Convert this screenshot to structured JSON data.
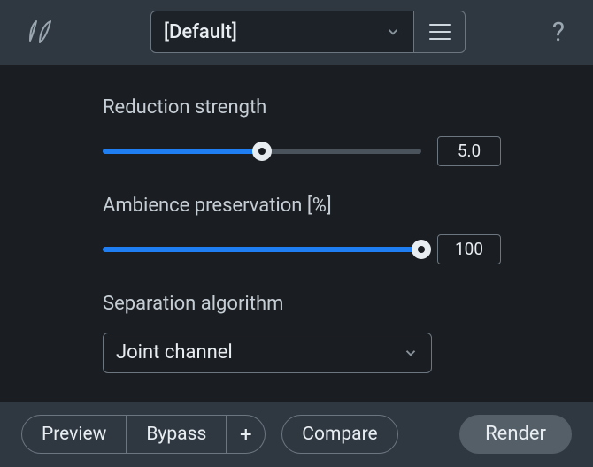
{
  "topbar": {
    "preset_value": "[Default]"
  },
  "controls": {
    "reduction": {
      "label": "Reduction strength",
      "value": "5.0",
      "fill_pct": 50
    },
    "ambience": {
      "label": "Ambience preservation [%]",
      "value": "100",
      "fill_pct": 100
    },
    "separation": {
      "label": "Separation algorithm",
      "value": "Joint channel"
    }
  },
  "bottombar": {
    "preview": "Preview",
    "bypass": "Bypass",
    "plus": "+",
    "compare": "Compare",
    "render": "Render"
  }
}
